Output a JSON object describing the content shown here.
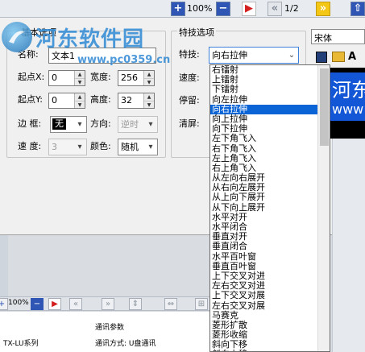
{
  "top_toolbar": {
    "zoom": "100%",
    "page": "1/2"
  },
  "watermark": {
    "title": "河东软件园",
    "url": "www.pc0359.cn"
  },
  "basic_group": {
    "title": "基本选项",
    "name_label": "名称:",
    "name_value": "文本1",
    "startx_label": "起点X:",
    "startx_value": "0",
    "width_label": "宽度:",
    "width_value": "256",
    "starty_label": "起点Y:",
    "starty_value": "0",
    "height_label": "高度:",
    "height_value": "32",
    "border_label": "边 框:",
    "border_value": "无",
    "direction_label": "方向:",
    "direction_value": "逆时",
    "speed_label": "速 度:",
    "speed_value": "3",
    "color_label": "颜色:",
    "color_value": "随机"
  },
  "effect_group": {
    "title": "特技选项",
    "effect_label": "特技:",
    "effect_value": "向右拉伸",
    "speed_label": "速度:",
    "pause_label": "停留:",
    "clear_label": "清屏:"
  },
  "effect_list": [
    "右镭射",
    "上镭射",
    "下镭射",
    "向左拉伸",
    "向右拉伸",
    "向上拉伸",
    "向下拉伸",
    "左下角飞入",
    "右下角飞入",
    "左上角飞入",
    "右上角飞入",
    "从左向右展开",
    "从右向左展开",
    "从上向下展开",
    "从下向上展开",
    "水平对开",
    "水平闭合",
    "垂直对开",
    "垂直闭合",
    "水平百叶窗",
    "垂直百叶窗",
    "上下交叉对进",
    "左右交叉对进",
    "上下交叉对展",
    "左右交叉对展",
    "马赛克",
    "菱形扩散",
    "菱形收缩",
    "斜向下移",
    "斜向上移"
  ],
  "effect_list_selected_index": 4,
  "right_panel": {
    "font": "宋体",
    "preview_text": "河东",
    "preview_sub": "www"
  },
  "bottom": {
    "zoom": "100%",
    "device": "TX-LU系列",
    "comm_title": "通讯参数",
    "comm_mode": "通讯方式:  U盘通讯"
  }
}
